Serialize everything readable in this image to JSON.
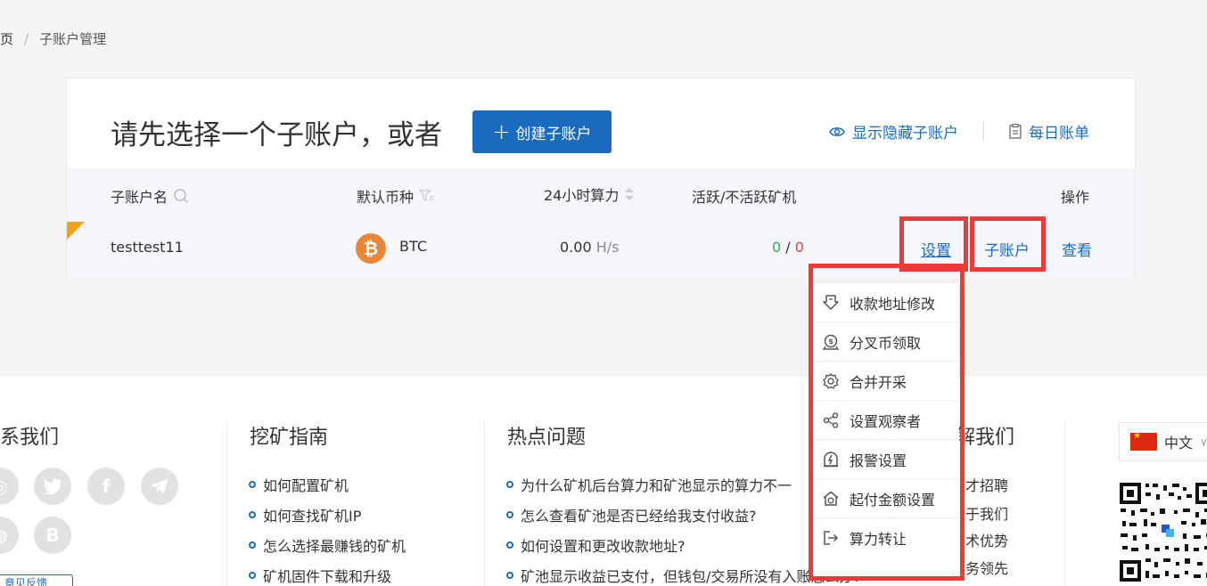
{
  "breadcrumb": {
    "home": "页",
    "separator": "/",
    "current": "子账户管理"
  },
  "header": {
    "title": "请先选择一个子账户，或者",
    "create_button": "创建子账户",
    "show_hidden": "显示隐藏子账户",
    "daily_bill": "每日账单"
  },
  "table": {
    "columns": {
      "name": "子账户名",
      "coin": "默认币种",
      "hashrate": "24小时算力",
      "workers": "活跃/不活跃矿机",
      "actions": "操作"
    },
    "rows": [
      {
        "name": "testtest11",
        "coin_icon": "₿",
        "coin": "BTC",
        "hashrate_value": "0.00",
        "hashrate_unit": "H/s",
        "active": "0",
        "slash": "/",
        "inactive": "0",
        "action_settings": "设置",
        "action_subaccount": "子账户",
        "action_view": "查看"
      }
    ]
  },
  "dropdown": {
    "items": [
      {
        "label": "收款地址修改",
        "icon": "download-address-icon"
      },
      {
        "label": "分叉币领取",
        "icon": "fork-coin-icon"
      },
      {
        "label": "合并开采",
        "icon": "gear-icon"
      },
      {
        "label": "设置观察者",
        "icon": "share-icon"
      },
      {
        "label": "报警设置",
        "icon": "alarm-icon"
      },
      {
        "label": "起付金额设置",
        "icon": "home-coin-icon"
      },
      {
        "label": "算力转让",
        "icon": "logout-icon"
      }
    ]
  },
  "footer": {
    "contact": {
      "title": "系我们",
      "socials": [
        "weibo-icon",
        "twitter-icon",
        "facebook-icon",
        "telegram-icon",
        "wechat-icon",
        "bitcoin-b-icon"
      ],
      "feedback": "意见反馈"
    },
    "guide": {
      "title": "挖矿指南",
      "links": [
        "如何配置矿机",
        "如何查找矿机IP",
        "怎么选择最赚钱的矿机",
        "矿机固件下载和升级"
      ]
    },
    "hot": {
      "title": "热点问题",
      "links": [
        "为什么矿机后台算力和矿池显示的算力不一",
        "怎么查看矿池是否已经给我支付收益?",
        "如何设置和更改收款地址?",
        "矿池显示收益已支付，但钱包/交易所没有入账怎么办?"
      ]
    },
    "about": {
      "title": "解我们",
      "links": [
        "才招聘",
        "于我们",
        "术优势",
        "务领先"
      ]
    },
    "language": "中文"
  },
  "colors": {
    "primary": "#1a6bbd",
    "highlight": "#ee3a3a",
    "btc": "#e8863a",
    "active": "#3da35d",
    "inactive": "#e24141",
    "corner": "#f4a21d"
  }
}
